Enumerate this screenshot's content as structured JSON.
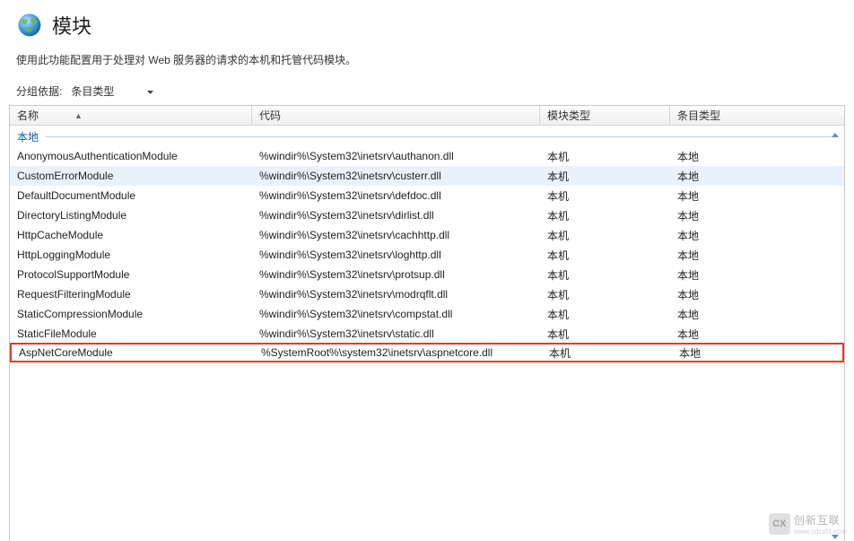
{
  "header": {
    "title": "模块",
    "subtitle": "使用此功能配置用于处理对 Web 服务器的请求的本机和托管代码模块。"
  },
  "toolbar": {
    "group_by_label": "分组依据:",
    "dropdown_value": "条目类型"
  },
  "columns": {
    "name": "名称",
    "code": "代码",
    "module_type": "模块类型",
    "entry_type": "条目类型"
  },
  "group": {
    "label": "本地"
  },
  "rows": [
    {
      "name": "AnonymousAuthenticationModule",
      "code": "%windir%\\System32\\inetsrv\\authanon.dll",
      "module_type": "本机",
      "entry_type": "本地",
      "highlight": false,
      "hover": false
    },
    {
      "name": "CustomErrorModule",
      "code": "%windir%\\System32\\inetsrv\\custerr.dll",
      "module_type": "本机",
      "entry_type": "本地",
      "highlight": false,
      "hover": true
    },
    {
      "name": "DefaultDocumentModule",
      "code": "%windir%\\System32\\inetsrv\\defdoc.dll",
      "module_type": "本机",
      "entry_type": "本地",
      "highlight": false,
      "hover": false
    },
    {
      "name": "DirectoryListingModule",
      "code": "%windir%\\System32\\inetsrv\\dirlist.dll",
      "module_type": "本机",
      "entry_type": "本地",
      "highlight": false,
      "hover": false
    },
    {
      "name": "HttpCacheModule",
      "code": "%windir%\\System32\\inetsrv\\cachhttp.dll",
      "module_type": "本机",
      "entry_type": "本地",
      "highlight": false,
      "hover": false
    },
    {
      "name": "HttpLoggingModule",
      "code": "%windir%\\System32\\inetsrv\\loghttp.dll",
      "module_type": "本机",
      "entry_type": "本地",
      "highlight": false,
      "hover": false
    },
    {
      "name": "ProtocolSupportModule",
      "code": "%windir%\\System32\\inetsrv\\protsup.dll",
      "module_type": "本机",
      "entry_type": "本地",
      "highlight": false,
      "hover": false
    },
    {
      "name": "RequestFilteringModule",
      "code": "%windir%\\System32\\inetsrv\\modrqflt.dll",
      "module_type": "本机",
      "entry_type": "本地",
      "highlight": false,
      "hover": false
    },
    {
      "name": "StaticCompressionModule",
      "code": "%windir%\\System32\\inetsrv\\compstat.dll",
      "module_type": "本机",
      "entry_type": "本地",
      "highlight": false,
      "hover": false
    },
    {
      "name": "StaticFileModule",
      "code": "%windir%\\System32\\inetsrv\\static.dll",
      "module_type": "本机",
      "entry_type": "本地",
      "highlight": false,
      "hover": false
    },
    {
      "name": "AspNetCoreModule",
      "code": "%SystemRoot%\\system32\\inetsrv\\aspnetcore.dll",
      "module_type": "本机",
      "entry_type": "本地",
      "highlight": true,
      "hover": false
    }
  ],
  "watermark": {
    "brand": "创新互联",
    "url": "www.cdcxhl.com",
    "logo_text": "CX"
  }
}
